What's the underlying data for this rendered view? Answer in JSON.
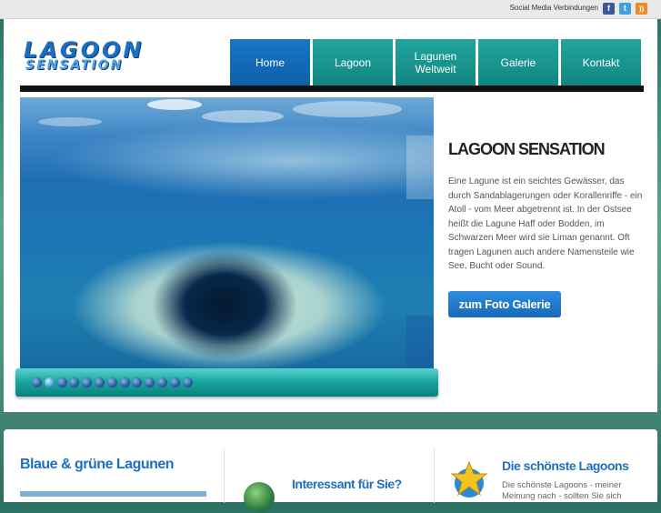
{
  "topbar": {
    "social_label": "Social Media Verbindungen",
    "icons": [
      "facebook-icon",
      "twitter-icon",
      "rss-icon"
    ],
    "fb_glyph": "f",
    "tw_glyph": "t",
    "rss_glyph": "))"
  },
  "logo": {
    "line1": "LAGOON",
    "line2": "SENSATION"
  },
  "nav": {
    "items": [
      "Home",
      "Lagoon",
      "Lagunen Weltweit",
      "Galerie",
      "Kontakt"
    ],
    "active": "Home"
  },
  "hero": {
    "title": "LAGOON SENSATION",
    "text": "Eine Lagune ist ein seichtes Gewässer, das durch Sandablagerungen oder Korallenriffe - ein Atoll - vom Meer abgetrennt ist. In der Ostsee heißt die Lagune Haff oder Bodden, im Schwarzen Meer wird sie Liman genannt. Oft tragen Lagunen auch andere Namensteile wie See, Bucht oder Sound.",
    "button": "zum Foto Galerie"
  },
  "slider": {
    "slide_count": 13,
    "active_index": 1
  },
  "bottom": {
    "col1_title": "Blaue & grüne Lagunen",
    "col2_title": "Interessant für Sie?",
    "col3_title": "Die schönste Lagoons",
    "col3_text": "Die schönste Lagoons - meiner Meinung nach - sollten Sie sich"
  },
  "colors": {
    "nav_active": "#1876c8",
    "nav_item": "#1aa09a",
    "accent_blue": "#1d70c0"
  }
}
